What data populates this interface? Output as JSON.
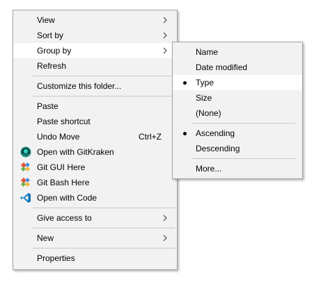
{
  "main_menu": {
    "view": "View",
    "sort_by": "Sort by",
    "group_by": "Group by",
    "refresh": "Refresh",
    "customize": "Customize this folder...",
    "paste": "Paste",
    "paste_shortcut": "Paste shortcut",
    "undo_move": "Undo Move",
    "undo_shortcut": "Ctrl+Z",
    "gitkraken": "Open with GitKraken",
    "git_gui": "Git GUI Here",
    "git_bash": "Git Bash Here",
    "open_code": "Open with Code",
    "give_access": "Give access to",
    "new": "New",
    "properties": "Properties"
  },
  "sub_menu": {
    "name": "Name",
    "date_modified": "Date modified",
    "type": "Type",
    "size": "Size",
    "none": "(None)",
    "ascending": "Ascending",
    "descending": "Descending",
    "more": "More..."
  },
  "selected": {
    "group_by": "Type",
    "order": "Ascending"
  },
  "icons": {
    "gitkraken": "gitkraken-icon",
    "git_gui": "git-gui-icon",
    "git_bash": "git-bash-icon",
    "vscode": "vscode-icon",
    "submenu_arrow": "chevron-right-icon"
  },
  "colors": {
    "menu_bg": "#f2f2f2",
    "highlight_bg": "#ffffff",
    "separator": "#c8c8c8",
    "border": "#a0a0a0",
    "vscode_blue": "#2489ca",
    "gitkraken_teal": "#179287"
  }
}
